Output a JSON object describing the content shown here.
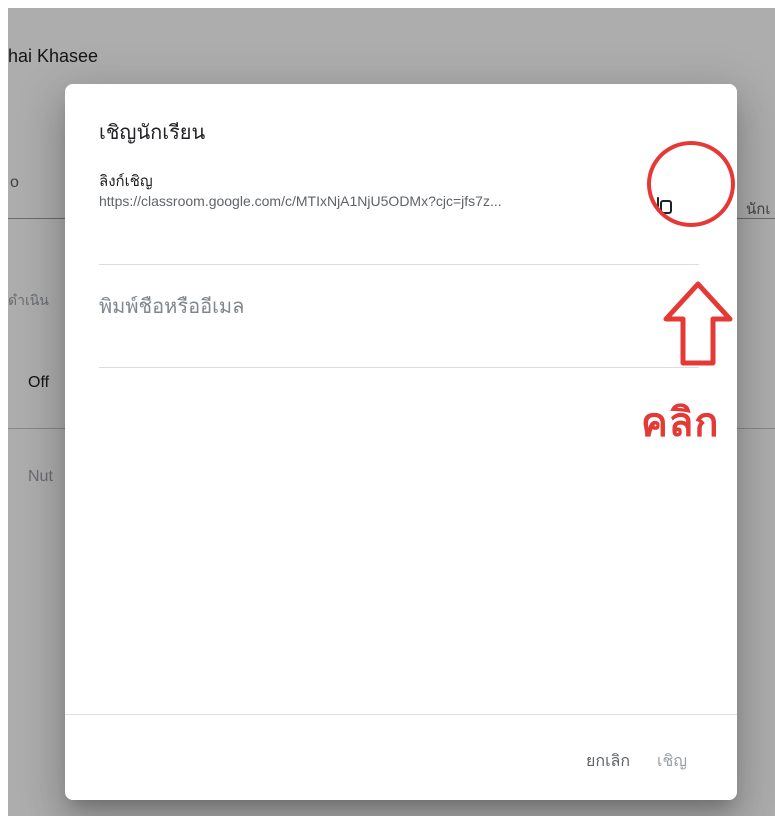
{
  "background": {
    "title": "hai Khasee",
    "tab_left": "o",
    "tab_right": "นักเ",
    "filter_text": "ดำเนิน",
    "row_1": "Off",
    "row_2": "Nut"
  },
  "dialog": {
    "title": "เชิญนักเรียน",
    "link_label": "ลิงก์เชิญ",
    "link_url": "https://classroom.google.com/c/MTIxNjA1NjU5ODMx?cjc=jfs7z...",
    "copy_icon": "content-copy-icon",
    "input_placeholder": "พิมพ์ชื่อหรืออีเมล",
    "input_value": "",
    "buttons": {
      "cancel": "ยกเลิก",
      "invite": "เชิญ"
    }
  },
  "annotation": {
    "text": "คลิก",
    "color": "#e53935",
    "arrow_icon": "up-arrow-icon"
  },
  "colors": {
    "scrim": "rgba(0,0,0,0.32)",
    "dialog_bg": "#ffffff",
    "muted_text": "#5f6368",
    "disabled_text": "#9aa0a6"
  }
}
